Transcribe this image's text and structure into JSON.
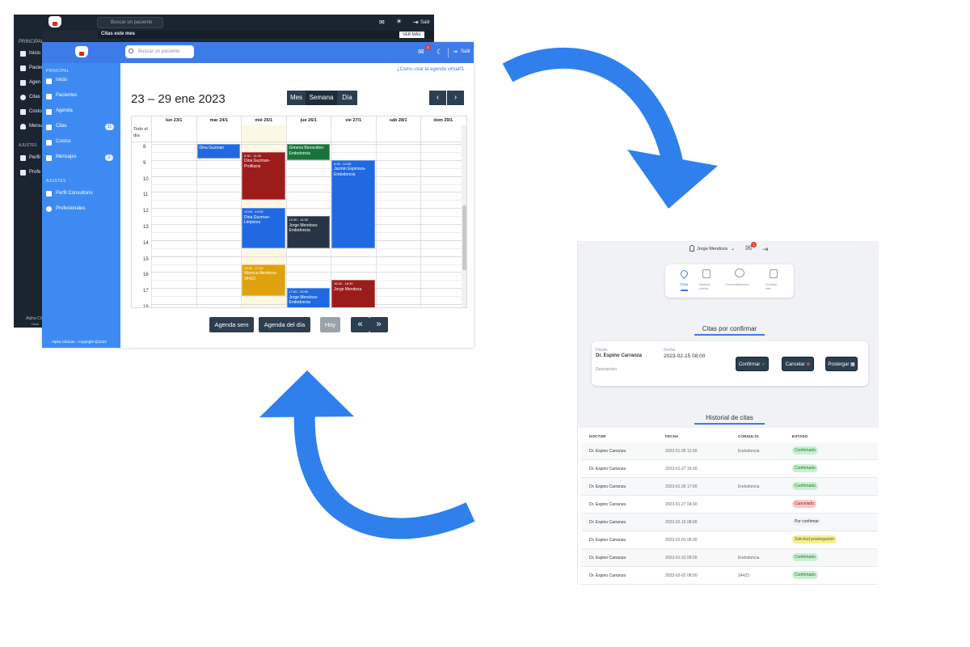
{
  "dark_window": {
    "search_placeholder": "Buscar un paciente",
    "logout_label": "Salir",
    "section_principal": "PRINCIPAL",
    "citas_banner": "Citas este mes",
    "ver_mas": "VER MÁS",
    "nav_items": [
      "Inicio",
      "Pacien",
      "Agen",
      "Citas",
      "Costo",
      "Mensa"
    ],
    "section_ajustes": "AJUSTES",
    "settings_items": [
      "Perfil",
      "Profe"
    ],
    "footer": "Alpha Cli",
    "footer_sub": "Dese"
  },
  "front_window": {
    "search_placeholder": "Buscar un paciente",
    "logout_label": "Salir",
    "messages_badge": "2",
    "sidebar": {
      "section_principal": "PRINCIPAL",
      "items": [
        {
          "label": "Inicio",
          "icon": "home-icon",
          "badge": ""
        },
        {
          "label": "Pacientes",
          "icon": "users-icon",
          "badge": ""
        },
        {
          "label": "Agenda",
          "icon": "calendar-icon",
          "badge": ""
        },
        {
          "label": "Citas",
          "icon": "pin-icon",
          "badge": "11"
        },
        {
          "label": "Costos",
          "icon": "receipt-icon",
          "badge": ""
        },
        {
          "label": "Mensajes",
          "icon": "bell-icon",
          "badge": "2"
        }
      ],
      "section_ajustes": "AJUSTES",
      "settings_items": [
        {
          "label": "Perfil Consultorio",
          "icon": "clinic-icon"
        },
        {
          "label": "Profesionales",
          "icon": "team-icon"
        }
      ],
      "footer": "Alpha Clinicas - Copyright @2023"
    },
    "help_link": "¿Como usar la agenda virtual?",
    "calendar": {
      "title": "23 – 29 ene 2023",
      "views": [
        "Mes",
        "Semana",
        "Día"
      ],
      "active_view": "Semana",
      "prev_label": "‹",
      "next_label": "›",
      "all_day_label": "Todo el día",
      "days": [
        "lun 23/1",
        "mar 24/1",
        "mié 25/1",
        "jue 26/1",
        "vie 27/1",
        "sáb 28/1",
        "dom 29/1"
      ],
      "hours": [
        "8",
        "9",
        "10",
        "11",
        "12",
        "13",
        "14",
        "15",
        "16",
        "17",
        "18"
      ],
      "events": [
        {
          "day": 1,
          "start": 8.0,
          "end": 8.9,
          "time": "",
          "title": "Dina Guzman",
          "color": "#2069e0"
        },
        {
          "day": 2,
          "start": 8.5,
          "end": 11.5,
          "time": "8:30 - 11:30",
          "title": "Dina Guzman-Profilaxis",
          "color": "#9c1c1c"
        },
        {
          "day": 3,
          "start": 8.0,
          "end": 9.0,
          "time": "",
          "title": "Gimena Benavides-Endodoncia",
          "color": "#17753c"
        },
        {
          "day": 4,
          "start": 9.0,
          "end": 14.5,
          "time": "9:00 - 14:30",
          "title": "Jazmin Espinoza-Endodoncia",
          "color": "#2069e0"
        },
        {
          "day": 2,
          "start": 12.0,
          "end": 14.5,
          "time": "12:00 - 14:30",
          "title": "Dina Guzman-Limpieza",
          "color": "#2069e0"
        },
        {
          "day": 3,
          "start": 12.5,
          "end": 14.5,
          "time": "12:30 - 14:30",
          "title": "Jorge Mendoza-Endodoncia",
          "color": "#263445"
        },
        {
          "day": 2,
          "start": 15.5,
          "end": 17.5,
          "time": "15:30 - 17:30",
          "title": "Mavoca Mendoza-34423",
          "color": "#e0a10e"
        },
        {
          "day": 4,
          "start": 16.5,
          "end": 18.5,
          "time": "16:30 - 18:30",
          "title": "Jorge Mendoza",
          "color": "#9c1c1c"
        },
        {
          "day": 3,
          "start": 17.0,
          "end": 20.0,
          "time": "17:00 - 20:00",
          "title": "Jorge Mendoza-Endodoncia",
          "color": "#2069e0"
        }
      ]
    },
    "bottom_buttons": {
      "agenda_sem": "Agenda sem",
      "agenda_dia": "Agenda del día",
      "hoy": "Hoy",
      "prev": "«",
      "next": "»"
    }
  },
  "right_window": {
    "user_name": "Jorge Mendoza",
    "notif_badge": "1",
    "tabs": [
      {
        "label": "Citas",
        "icon": "pin-icon"
      },
      {
        "label": "Historia clínica",
        "icon": "document-icon"
      },
      {
        "label": "Consentimientos",
        "icon": "handshake-icon"
      },
      {
        "label": "Solicitar cita",
        "icon": "calendar-icon"
      }
    ],
    "pending_title": "Citas por confirmar",
    "pending": {
      "doctor_label": "Doctor",
      "doctor": "Dr. Espino Carranza",
      "fecha_label": "Fecha",
      "fecha": "2023-02-15 08:00",
      "descripcion_label": "Descripción",
      "confirm": "Confirmar",
      "cancel": "Cancelar",
      "postpone": "Postergar"
    },
    "history_title": "Historial de citas",
    "history_headers": [
      "DOCTOR",
      "FECHA",
      "CONSULTA",
      "ESTADO"
    ],
    "history": [
      {
        "doctor": "Dr. Espino Carranza",
        "fecha": "2023-01-26 12:30",
        "consulta": "Endodoncia",
        "estado": "Confirmado",
        "kind": "confirmed"
      },
      {
        "doctor": "Dr. Espino Carranza",
        "fecha": "2023-01-27 16:30",
        "consulta": "",
        "estado": "Confirmado",
        "kind": "confirmed"
      },
      {
        "doctor": "Dr. Espino Carranza",
        "fecha": "2023-01-26 17:00",
        "consulta": "Endodoncia",
        "estado": "Confirmado",
        "kind": "confirmed"
      },
      {
        "doctor": "Dr. Espino Carranza",
        "fecha": "2023-01-27 04:30",
        "consulta": "",
        "estado": "Cancelado",
        "kind": "cancelled"
      },
      {
        "doctor": "Dr. Espino Carranza",
        "fecha": "2023-02-15 08:00",
        "consulta": "",
        "estado": "Por confirmar",
        "kind": "pending"
      },
      {
        "doctor": "Dr. Espino Carranza",
        "fecha": "2023-02-01 06:30",
        "consulta": "",
        "estado": "Solicitud postergación",
        "kind": "postpone"
      },
      {
        "doctor": "Dr. Espino Carranza",
        "fecha": "2023-01-31 09:00",
        "consulta": "Endodoncia",
        "estado": "Confirmado",
        "kind": "confirmed"
      },
      {
        "doctor": "Dr. Espino Carranza",
        "fecha": "2023-02-02 08:00",
        "consulta": "34423",
        "estado": "Confirmado",
        "kind": "confirmed"
      }
    ]
  },
  "colors": {
    "arrow": "#2f80ed",
    "topbar": "#3d7be9",
    "sidebar": "#3d8bf2",
    "dark_bg": "#1f2a36",
    "button_dark": "#2c3e50"
  }
}
